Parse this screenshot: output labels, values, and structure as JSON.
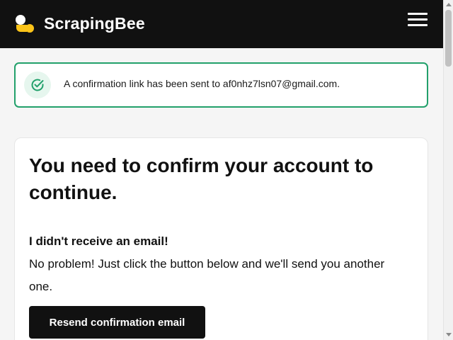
{
  "header": {
    "brand_name": "ScrapingBee",
    "logo_icon": "bee-logo-icon",
    "menu_icon": "hamburger-menu-icon",
    "background_color": "#111111",
    "logo_yellow": "#fcc419"
  },
  "alert": {
    "icon": "check-circle-icon",
    "message": "A confirmation link has been sent to af0nhz7lsn07@gmail.com.",
    "border_color": "#22a06b"
  },
  "card": {
    "title": "You need to confirm your account to continue.",
    "subheading": "I didn't receive an email!",
    "body": "No problem! Just click the button below and we'll send you another one.",
    "button_label": "Resend confirmation email"
  }
}
